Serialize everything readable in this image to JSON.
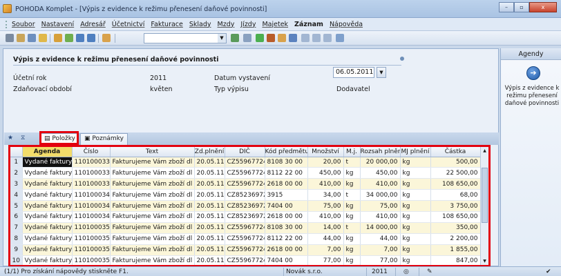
{
  "window": {
    "title": "POHODA Komplet - [Výpis z evidence k režimu přenesení daňové povinnosti]",
    "minimize": "–",
    "maximize": "▫",
    "close": "x"
  },
  "menu": [
    "Soubor",
    "Nastavení",
    "Adresář",
    "Účetnictví",
    "Fakturace",
    "Sklady",
    "Mzdy",
    "Jízdy",
    "Majetek",
    "Záznam",
    "Nápověda"
  ],
  "form": {
    "title": "Výpis z evidence k režimu přenesení daňové povinnosti",
    "ucetni_rok_label": "Účetní rok",
    "ucetni_rok_value": "2011",
    "obdobi_label": "Zdaňovací období",
    "obdobi_value": "květen",
    "datum_label": "Datum vystavení",
    "datum_value": "06.05.2011",
    "typ_label": "Typ výpisu",
    "typ_value": "Dodavatel"
  },
  "tabs": {
    "polozky": "Položky",
    "poznamky": "Poznámky"
  },
  "grid": {
    "columns": [
      "Agenda",
      "Číslo",
      "Text",
      "Zd.plnění",
      "DIČ",
      "Kód předmětu",
      "Množství",
      "M.j.",
      "Rozsah plnění",
      "MJ plnění",
      "Částka"
    ],
    "rows": [
      [
        "1",
        "Vydané faktury",
        "110100033",
        "Fakturujeme Vám zboží dl",
        "20.05.11",
        "CZ55967724",
        "8108 30 00",
        "20,00",
        "t",
        "20 000,00",
        "kg",
        "500,00"
      ],
      [
        "2",
        "Vydané faktury",
        "110100033",
        "Fakturujeme Vám zboží dl",
        "20.05.11",
        "CZ55967724",
        "8112 22 00",
        "450,00",
        "kg",
        "450,00",
        "kg",
        "22 500,00"
      ],
      [
        "3",
        "Vydané faktury",
        "110100033",
        "Fakturujeme Vám zboží dl",
        "20.05.11",
        "CZ55967724",
        "2618 00 00",
        "410,00",
        "kg",
        "410,00",
        "kg",
        "108 650,00"
      ],
      [
        "4",
        "Vydané faktury",
        "110100034",
        "Fakturujeme Vám zboží dl",
        "20.05.11",
        "CZ85236972",
        "3915",
        "34,00",
        "t",
        "34 000,00",
        "kg",
        "68,00"
      ],
      [
        "5",
        "Vydané faktury",
        "110100034",
        "Fakturujeme Vám zboží dl",
        "20.05.11",
        "CZ85236972",
        "7404 00",
        "75,00",
        "kg",
        "75,00",
        "kg",
        "3 750,00"
      ],
      [
        "6",
        "Vydané faktury",
        "110100034",
        "Fakturujeme Vám zboží dl",
        "20.05.11",
        "CZ85236972",
        "2618 00 00",
        "410,00",
        "kg",
        "410,00",
        "kg",
        "108 650,00"
      ],
      [
        "7",
        "Vydané faktury",
        "110100035",
        "Fakturujeme Vám zboží dl",
        "20.05.11",
        "CZ55967724",
        "8108 30 00",
        "14,00",
        "t",
        "14 000,00",
        "kg",
        "350,00"
      ],
      [
        "8",
        "Vydané faktury",
        "110100035",
        "Fakturujeme Vám zboží dl",
        "20.05.11",
        "CZ55967724",
        "8112 22 00",
        "44,00",
        "kg",
        "44,00",
        "kg",
        "2 200,00"
      ],
      [
        "9",
        "Vydané faktury",
        "110100035",
        "Fakturujeme Vám zboží dl",
        "20.05.11",
        "CZ55967724",
        "2618 00 00",
        "7,00",
        "kg",
        "7,00",
        "kg",
        "1 855,00"
      ],
      [
        "10",
        "Vydané faktury",
        "110100035",
        "Fakturujeme Vám zboží dl",
        "20.05.11",
        "CZ55967724",
        "7404 00",
        "77,00",
        "kg",
        "77,00",
        "kg",
        "847,00"
      ]
    ]
  },
  "sidepanel": {
    "header": "Agendy",
    "description": "Výpis z evidence k režimu přenesení daňové povinnosti"
  },
  "status": {
    "help": "(1/1) Pro získání nápovědy stiskněte F1.",
    "user": "Novák s.r.o.",
    "year": "2011"
  }
}
